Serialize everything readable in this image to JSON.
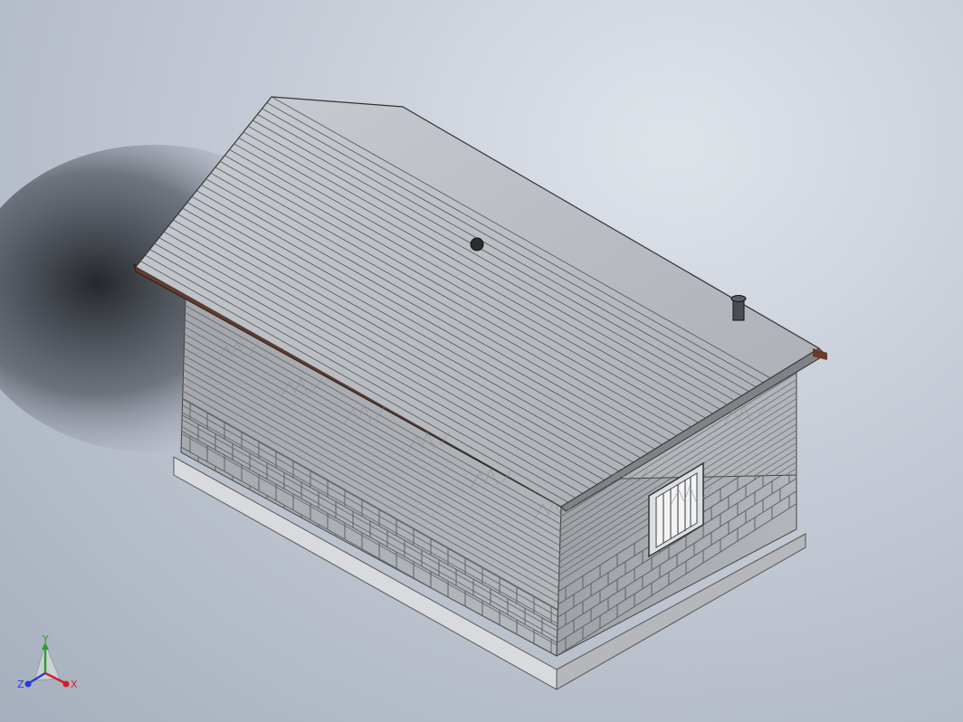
{
  "viewport": {
    "background": "#c6ccd6",
    "model": {
      "name": "house",
      "roof_color": "#b9bcc0",
      "roof_dark": "#8e9196",
      "wall_color": "#a9acb0",
      "wall_dark": "#8d9095",
      "fascia_color": "#6b3a2a",
      "base_color": "#c4c6c9",
      "watermark_text": "mfcad"
    },
    "triad": {
      "x_label": "X",
      "y_label": "Y",
      "z_label": "Z",
      "x_color": "#d0202a",
      "y_color": "#2aa02a",
      "z_color": "#2a3ad0"
    }
  }
}
